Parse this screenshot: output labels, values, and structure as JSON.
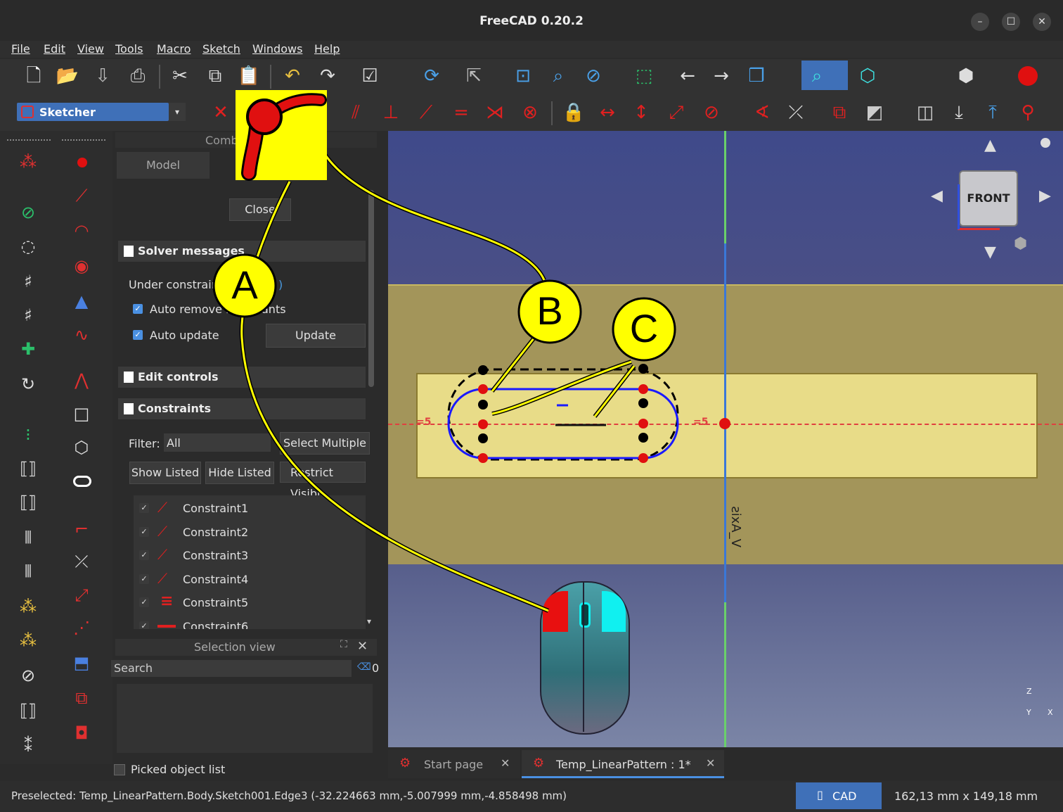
{
  "app": {
    "title": "FreeCAD 0.20.2"
  },
  "window_controls": {
    "minimize": "–",
    "maximize": "☐",
    "close": "✕"
  },
  "menu": [
    "File",
    "Edit",
    "View",
    "Tools",
    "Macro",
    "Sketch",
    "Windows",
    "Help"
  ],
  "workbench": {
    "name": "Sketcher"
  },
  "combo": {
    "header": "Comb",
    "tab_model": "Model",
    "close_label": "Close",
    "solver_title": "Solver messages",
    "under_constrained": "Under constrain",
    "under_constrained_tail": ")",
    "auto_remove": "Auto remove r",
    "auto_remove_tail": "ants",
    "auto_update": "Auto update",
    "update_btn": "Update",
    "edit_controls": "Edit controls",
    "constraints_title": "Constraints",
    "filter_label": "Filter:",
    "filter_value": "All",
    "select_multiple": "Select Multiple",
    "show_listed": "Show Listed",
    "hide_listed": "Hide Listed",
    "restrict_visibility": "Restrict Visibi",
    "constraints": [
      "Constraint1",
      "Constraint2",
      "Constraint3",
      "Constraint4",
      "Constraint5",
      "Constraint6"
    ]
  },
  "selection_view": {
    "title": "Selection view",
    "search_placeholder": "Search",
    "count": "0",
    "picked_list": "Picked object list"
  },
  "view3d": {
    "navcube_face": "FRONT",
    "axis_label": "V_Axis",
    "dim_left": "=5",
    "dim_right": "=5",
    "triad": {
      "z": "Z",
      "y": "Y",
      "x": "X"
    }
  },
  "annotations": {
    "a": "A",
    "b": "B",
    "c": "C"
  },
  "tabs": [
    {
      "label": "Start page",
      "close": "✕"
    },
    {
      "label": "Temp_LinearPattern : 1*",
      "close": "✕"
    }
  ],
  "status": {
    "preselected": "Preselected: Temp_LinearPattern.Body.Sketch001.Edge3 (-32.224663 mm,-5.007999 mm,-4.858498 mm)",
    "nav_style": "CAD",
    "dimensions": "162,13 mm x 149,18 mm"
  },
  "colors": {
    "accent": "#3f70b8",
    "highlight": "#ffff00",
    "constraint_red": "#e02020",
    "sketch_blue": "#1a1aff",
    "pad_yellow": "#e8dc88"
  }
}
